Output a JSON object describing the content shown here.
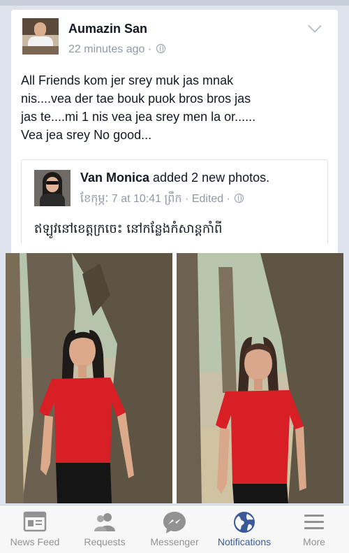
{
  "post": {
    "author": "Aumazin San",
    "time": "22 minutes ago",
    "meta_separator": "·",
    "text": "All Friends kom jer srey muk jas mnak\nnis....vea der tae bouk puok bros bros jas\njas te....mi 1 nis vea jea srey men la or......\nVea jea srey No good..."
  },
  "shared_post": {
    "author": "Van Monica",
    "action": "added 2 new photos.",
    "timestamp": "ខែកុម្ភៈ 7 at 10:41 ព្រឹក",
    "edited_label": "Edited",
    "caption": "ឥឡូវនៅខេត្តក្រចេះ នៅកន្លែងកំសាន្តកាំពី"
  },
  "tab_bar": {
    "items": [
      {
        "label": "News Feed",
        "icon": "news-feed-icon"
      },
      {
        "label": "Requests",
        "icon": "requests-icon"
      },
      {
        "label": "Messenger",
        "icon": "messenger-icon"
      },
      {
        "label": "Notifications",
        "icon": "globe-icon",
        "active": true
      },
      {
        "label": "More",
        "icon": "menu-icon"
      }
    ]
  },
  "colors": {
    "active_tab": "#3b5998",
    "inactive_tab": "#929292",
    "text_primary": "#141823",
    "text_secondary": "#9197a3",
    "background": "#dfe3ee"
  }
}
